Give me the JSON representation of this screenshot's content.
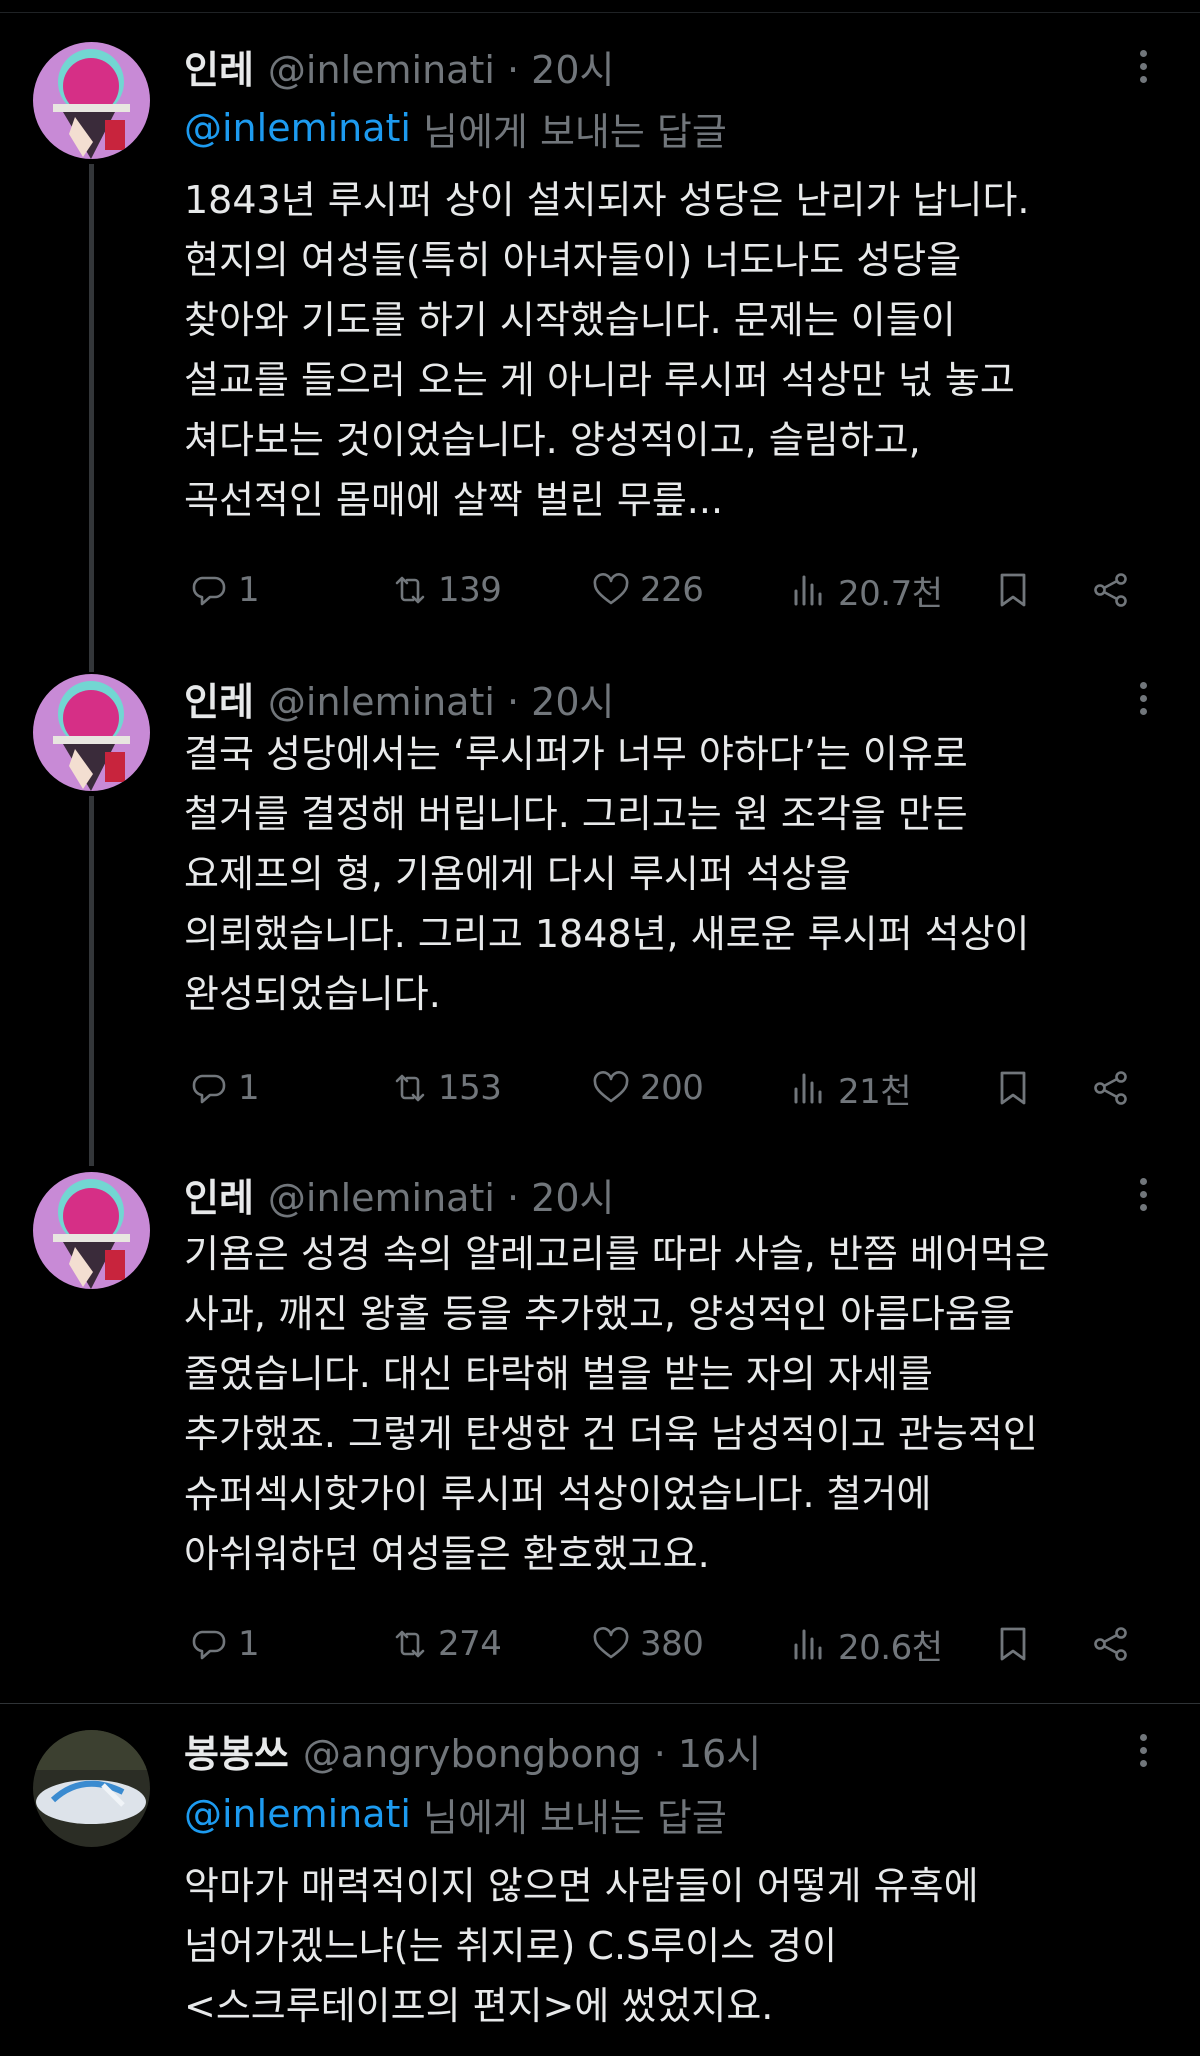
{
  "tweets": [
    {
      "name": "인레",
      "handle": "@inleminati · 20시",
      "reply_to": {
        "mention": "@inleminati",
        "suffix": "님에게 보내는 답글"
      },
      "lines": [
        "1843년 루시퍼 상이 설치되자 성당은 난리가 납니다.",
        "현지의 여성들(특히 아녀자들이) 너도나도 성당을",
        "찾아와 기도를 하기 시작했습니다. 문제는 이들이",
        "설교를 들으러 오는 게 아니라 루시퍼 석상만 넋 놓고",
        "쳐다보는 것이었습니다. 양성적이고, 슬림하고,",
        "곡선적인 몸매에 살짝 벌린 무릎..."
      ],
      "stats": {
        "replies": "1",
        "retweets": "139",
        "likes": "226",
        "views": "20.7천"
      }
    },
    {
      "name": "인레",
      "handle": "@inleminati · 20시",
      "lines": [
        "결국 성당에서는 ‘루시퍼가 너무 야하다’는 이유로",
        "철거를 결정해 버립니다. 그리고는 원 조각을 만든",
        "요제프의 형, 기욤에게 다시 루시퍼 석상을",
        "의뢰했습니다. 그리고 1848년, 새로운 루시퍼 석상이",
        "완성되었습니다."
      ],
      "stats": {
        "replies": "1",
        "retweets": "153",
        "likes": "200",
        "views": "21천"
      }
    },
    {
      "name": "인레",
      "handle": "@inleminati · 20시",
      "lines": [
        "기욤은 성경 속의 알레고리를 따라 사슬, 반쯤 베어먹은",
        "사과, 깨진 왕홀 등을 추가했고, 양성적인 아름다움을",
        "줄였습니다. 대신 타락해 벌을 받는 자의 자세를",
        "추가했죠. 그렇게 탄생한 건 더욱 남성적이고 관능적인",
        "슈퍼섹시핫가이 루시퍼 석상이었습니다. 철거에",
        "아쉬워하던 여성들은 환호했고요."
      ],
      "stats": {
        "replies": "1",
        "retweets": "274",
        "likes": "380",
        "views": "20.6천"
      }
    },
    {
      "name": "봉봉쓰",
      "handle": "@angrybongbong · 16시",
      "reply_to": {
        "mention": "@inleminati",
        "suffix": "님에게 보내는 답글"
      },
      "lines": [
        "악마가 매력적이지 않으면 사람들이 어떻게 유혹에",
        "넘어가겠느냐(는 취지로) C.S루이스 경이",
        "<스크루테이프의 편지>에 썼었지요."
      ]
    }
  ],
  "icons": [
    "reply-icon",
    "retweet-icon",
    "like-icon",
    "views-icon",
    "bookmark-icon",
    "share-icon",
    "more-icon"
  ],
  "colors": {
    "background": "#000000",
    "text": "#e7e9ea",
    "secondary": "#71767b",
    "link": "#1d9bf0",
    "divider": "#2f3336"
  }
}
